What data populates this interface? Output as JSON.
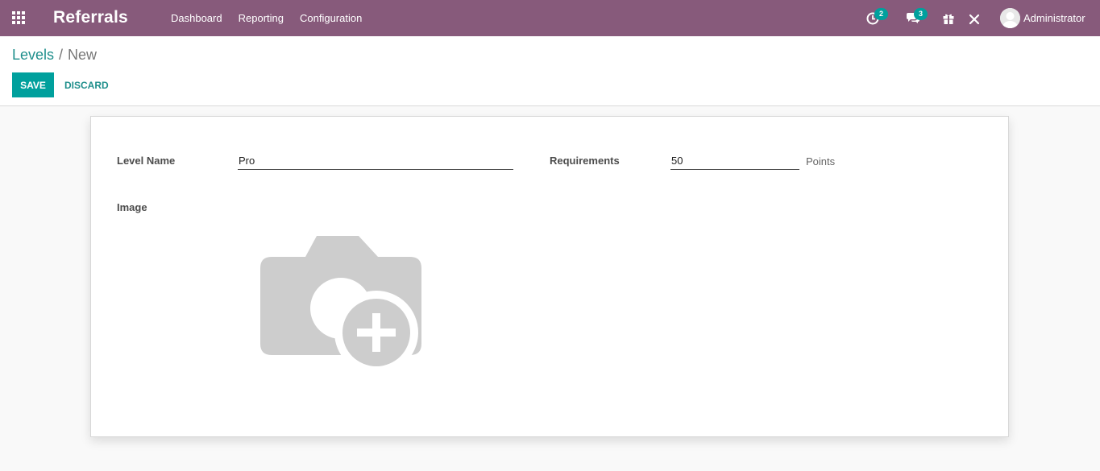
{
  "navbar": {
    "app_title": "Referrals",
    "menu": [
      "Dashboard",
      "Reporting",
      "Configuration"
    ],
    "activity_count": "2",
    "message_count": "3",
    "user_name": "Administrator",
    "brand_color": "#875a7b",
    "accent_color": "#00a09d"
  },
  "breadcrumb": {
    "parent": "Levels",
    "separator": "/",
    "current": "New"
  },
  "buttons": {
    "save": "SAVE",
    "discard": "DISCARD"
  },
  "form": {
    "level_name_label": "Level Name",
    "level_name_value": "Pro",
    "requirements_label": "Requirements",
    "requirements_value": "50",
    "requirements_suffix": "Points",
    "image_label": "Image",
    "image_icon": "camera-add-icon"
  }
}
